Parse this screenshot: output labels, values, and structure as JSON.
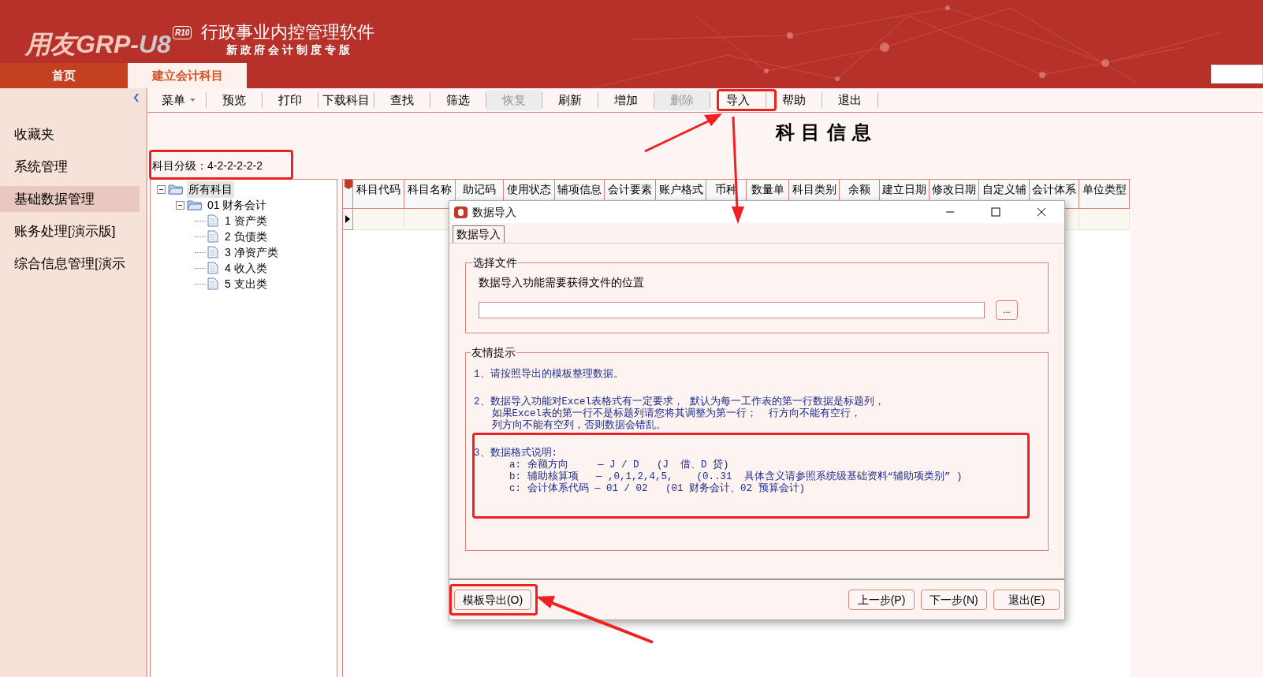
{
  "header": {
    "logo": {
      "brand": "用友GRP-",
      "mark": "U8",
      "edition": "R10"
    },
    "title": "行政事业内控管理软件",
    "subtitle": "新 政 府 会 计 制 度 专 版"
  },
  "tabs": [
    {
      "label": "首页",
      "selected": false
    },
    {
      "label": "建立会计科目",
      "selected": true
    }
  ],
  "sidebar": {
    "items": [
      {
        "label": "收藏夹",
        "selected": false
      },
      {
        "label": "系统管理",
        "selected": false
      },
      {
        "label": "基础数据管理",
        "selected": true
      },
      {
        "label": "账务处理[演示版]",
        "selected": false
      },
      {
        "label": "综合信息管理[演示",
        "selected": false
      }
    ]
  },
  "toolbar": [
    {
      "label": "菜单",
      "disabled": false,
      "dropdown": true
    },
    {
      "label": "预览",
      "disabled": false,
      "dropdown": false
    },
    {
      "label": "打印",
      "disabled": false,
      "dropdown": false
    },
    {
      "label": "下载科目",
      "disabled": false,
      "dropdown": false
    },
    {
      "label": "查找",
      "disabled": false,
      "dropdown": false
    },
    {
      "label": "筛选",
      "disabled": false,
      "dropdown": false
    },
    {
      "label": "恢复",
      "disabled": true,
      "dropdown": false
    },
    {
      "label": "刷新",
      "disabled": false,
      "dropdown": false
    },
    {
      "label": "增加",
      "disabled": false,
      "dropdown": false
    },
    {
      "label": "删除",
      "disabled": true,
      "dropdown": false
    },
    {
      "label": "导入",
      "disabled": false,
      "dropdown": false
    },
    {
      "label": "帮助",
      "disabled": false,
      "dropdown": false
    },
    {
      "label": "退出",
      "disabled": false,
      "dropdown": false
    }
  ],
  "page_title": "科 目 信 息",
  "level_label": "科目分级：4-2-2-2-2-2",
  "tree": [
    {
      "label": "所有科目",
      "expanded": true,
      "selected": true,
      "children": [
        {
          "label": "01 财务会计",
          "expanded": true,
          "selected": false,
          "children": [
            {
              "label": "1 资产类",
              "selected": false
            },
            {
              "label": "2 负债类",
              "selected": false
            },
            {
              "label": "3 净资产类",
              "selected": false
            },
            {
              "label": "4 收入类",
              "selected": false
            },
            {
              "label": "5 支出类",
              "selected": false
            }
          ]
        }
      ]
    }
  ],
  "grid": {
    "columns": [
      "科目代码",
      "科目名称",
      "助记码",
      "使用状态",
      "辅项信息",
      "会计要素",
      "账户格式",
      "币种",
      "数量单",
      "科目类别",
      "余额",
      "建立日期",
      "修改日期",
      "自定义辅",
      "会计体系",
      "单位类型"
    ]
  },
  "dialog": {
    "title": "数据导入",
    "tab": "数据导入",
    "file_group": {
      "legend": "选择文件",
      "prompt": "数据导入功能需要获得文件的位置",
      "browse": "..."
    },
    "tips_group": {
      "legend": "友情提示",
      "tips": [
        {
          "lines": [
            "1、请按照导出的模板整理数据。"
          ]
        },
        {
          "lines": [
            "2、数据导入功能对Excel表格式有一定要求， 默认为每一工作表的第一行数据是标题列，",
            "   如果Excel表的第一行不是标题列请您将其调整为第一行；  行方向不能有空行，",
            "   列方向不能有空列，否则数据会错乱。"
          ]
        },
        {
          "lines": [
            "3、数据格式说明:",
            "      a: 余额方向     — J / D   (J  借、D 贷)",
            "      b: 辅助核算项   — ,0,1,2,4,5,    (0..31  具体含义请参照系统级基础资料“辅助项类别” )",
            "      c: 会计体系代码 — 01 / 02   (01 财务会计、02 预算会计)"
          ]
        }
      ]
    },
    "buttons": [
      "模板导出(O)",
      "上一步(P)",
      "下一步(N)",
      "退出(E)"
    ]
  }
}
